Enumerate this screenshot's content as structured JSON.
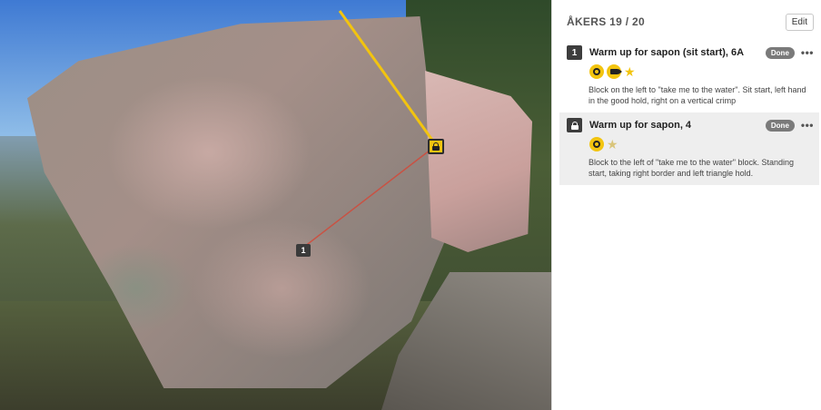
{
  "area": {
    "title": "ÅKERS 19 / 20",
    "edit_label": "Edit"
  },
  "routes": [
    {
      "badge": "1",
      "name": "Warm up for sapon (sit start), 6A",
      "status": "Done",
      "icons": [
        "topo-icon",
        "video-icon",
        "star-icon"
      ],
      "stars": "★",
      "description": "Block on the left to \"take me to the water\". Sit start, left hand in the good hold, right on a vertical crimp"
    },
    {
      "badge_icon": "lock-icon",
      "name": "Warm up for sapon, 4",
      "status": "Done",
      "icons": [
        "topo-icon",
        "star-half-icon"
      ],
      "stars": "★",
      "description": "Block to the left of \"take me to the water\" block. Standing start, taking right border and left triangle hold."
    }
  ],
  "photo": {
    "start_marker_label": "1"
  },
  "colors": {
    "accent": "#f2c40f",
    "badge": "#3d3d3d",
    "done": "#7a7a7a",
    "line_red": "#d24a3a"
  }
}
